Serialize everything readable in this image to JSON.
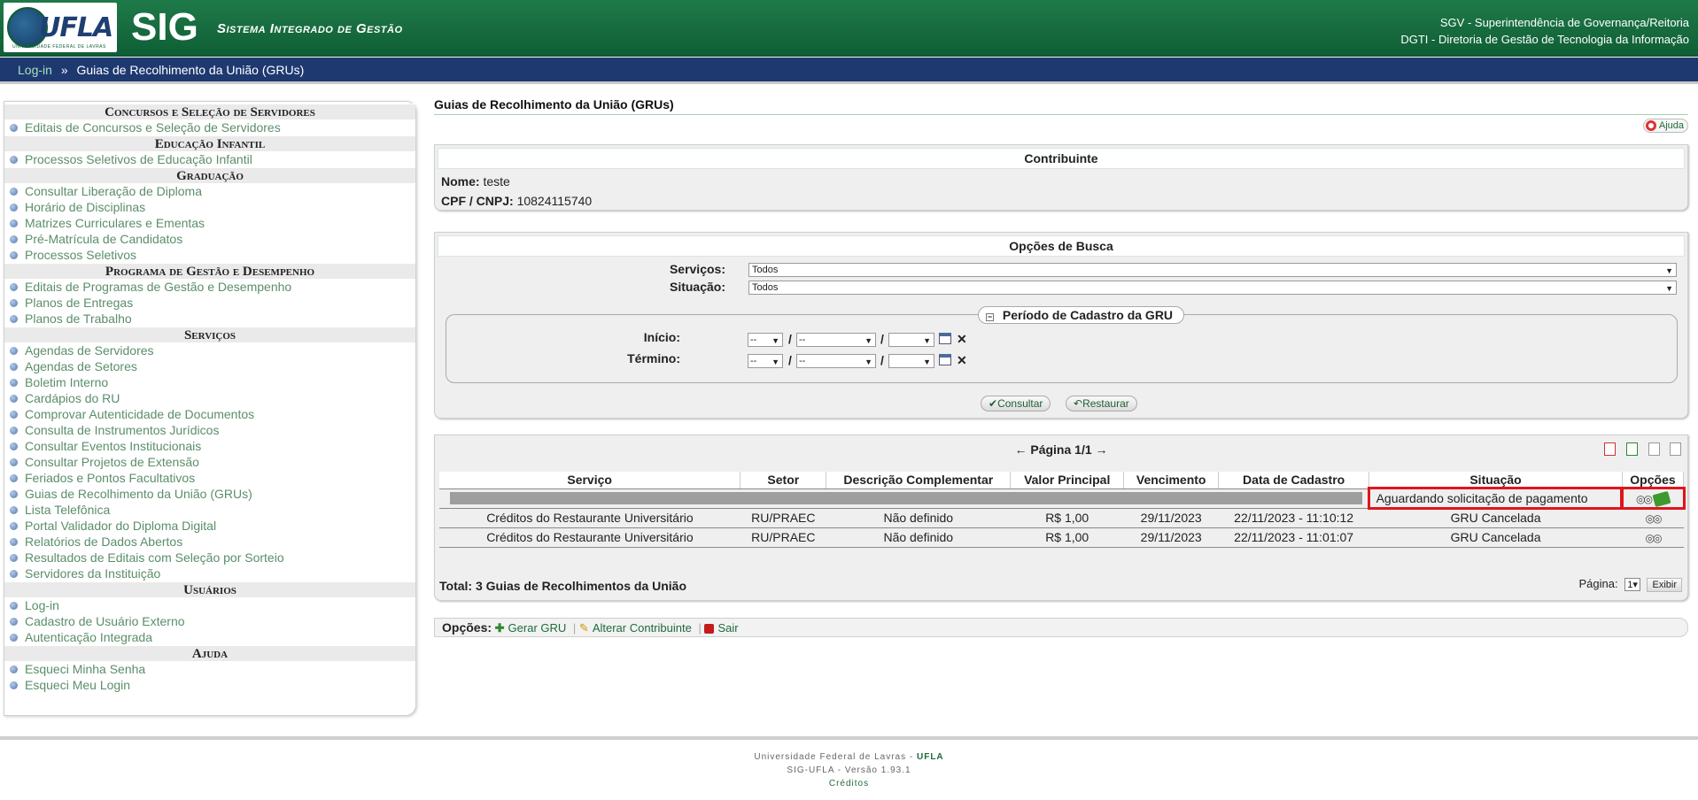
{
  "header": {
    "logo_text": "UFLA",
    "logo_subtext": "UNIVERSIDADE FEDERAL DE LAVRAS",
    "app_title": "SIG",
    "app_subtitle": "Sistema Integrado de Gestão",
    "right_line1": "SGV - Superintendência de Governança/Reitoria",
    "right_line2": "DGTI - Diretoria de Gestão de Tecnologia da Informação"
  },
  "breadcrumb": {
    "link": "Log-in",
    "separator": "»",
    "current": "Guias de Recolhimento da União (GRUs)"
  },
  "sidebar": {
    "sections": [
      {
        "title": "Concursos e Seleção de Servidores",
        "items": [
          "Editais de Concursos e Seleção de Servidores"
        ]
      },
      {
        "title": "Educação Infantil",
        "items": [
          "Processos Seletivos de Educação Infantil"
        ]
      },
      {
        "title": "Graduação",
        "items": [
          "Consultar Liberação de Diploma",
          "Horário de Disciplinas",
          "Matrizes Curriculares e Ementas",
          "Pré-Matrícula de Candidatos",
          "Processos Seletivos"
        ]
      },
      {
        "title": "Programa de Gestão e Desempenho",
        "items": [
          "Editais de Programas de Gestão e Desempenho",
          "Planos de Entregas",
          "Planos de Trabalho"
        ]
      },
      {
        "title": "Serviços",
        "items": [
          "Agendas de Servidores",
          "Agendas de Setores",
          "Boletim Interno",
          "Cardápios do RU",
          "Comprovar Autenticidade de Documentos",
          "Consulta de Instrumentos Jurídicos",
          "Consultar Eventos Institucionais",
          "Consultar Projetos de Extensão",
          "Feriados e Pontos Facultativos",
          "Guias de Recolhimento da União (GRUs)",
          "Lista Telefônica",
          "Portal Validador do Diploma Digital",
          "Relatórios de Dados Abertos",
          "Resultados de Editais com Seleção por Sorteio",
          "Servidores da Instituição"
        ]
      },
      {
        "title": "Usuários",
        "items": [
          "Log-in",
          "Cadastro de Usuário Externo",
          "Autenticação Integrada"
        ]
      },
      {
        "title": "Ajuda",
        "items": [
          "Esqueci Minha Senha",
          "Esqueci Meu Login"
        ]
      }
    ]
  },
  "main": {
    "page_title": "Guias de Recolhimento da União (GRUs)",
    "help_label": "Ajuda",
    "contribuinte": {
      "caption": "Contribuinte",
      "nome_label": "Nome:",
      "nome_value": "teste",
      "cpf_label": "CPF / CNPJ:",
      "cpf_value": "10824115740"
    },
    "busca": {
      "caption": "Opções de Busca",
      "servicos_label": "Serviços:",
      "servicos_value": "Todos",
      "situacao_label": "Situação:",
      "situacao_value": "Todos",
      "periodo_legend": "Período de Cadastro da GRU",
      "inicio_label": "Início:",
      "termino_label": "Término:",
      "date_placeholder": "--",
      "slash": "/",
      "clear": "✕",
      "consultar": "Consultar",
      "restaurar": "Restaurar"
    },
    "results": {
      "pager": "← Página 1/1 →",
      "columns": [
        "Serviço",
        "Setor",
        "Descrição Complementar",
        "Valor Principal",
        "Vencimento",
        "Data de Cadastro",
        "Situação",
        "Opções"
      ],
      "rows": [
        {
          "servico": "",
          "setor": "",
          "descricao": "",
          "valor": "",
          "vencimento": "",
          "cadastro": "",
          "situacao": "Aguardando solicitação de pagamento"
        },
        {
          "servico": "Créditos do Restaurante Universitário",
          "setor": "RU/PRAEC",
          "descricao": "Não definido",
          "valor": "R$ 1,00",
          "vencimento": "29/11/2023",
          "cadastro": "22/11/2023 - 11:10:12",
          "situacao": "GRU Cancelada"
        },
        {
          "servico": "Créditos do Restaurante Universitário",
          "setor": "RU/PRAEC",
          "descricao": "Não definido",
          "valor": "R$ 1,00",
          "vencimento": "29/11/2023",
          "cadastro": "22/11/2023 - 11:01:07",
          "situacao": "GRU Cancelada"
        }
      ],
      "total": "Total: 3 Guias de Recolhimentos da União",
      "pagina_label": "Página:",
      "pagina_value": "1",
      "exibir": "Exibir"
    },
    "opcoes": {
      "label": "Opções:",
      "gerar": "Gerar GRU",
      "alterar": "Alterar Contribuinte",
      "sair": "Sair"
    }
  },
  "footer": {
    "line1_prefix": "Universidade Federal de Lavras - ",
    "line1_bold": "UFLA",
    "line2": "SIG-UFLA - Versão 1.93.1",
    "line3": "Créditos"
  }
}
